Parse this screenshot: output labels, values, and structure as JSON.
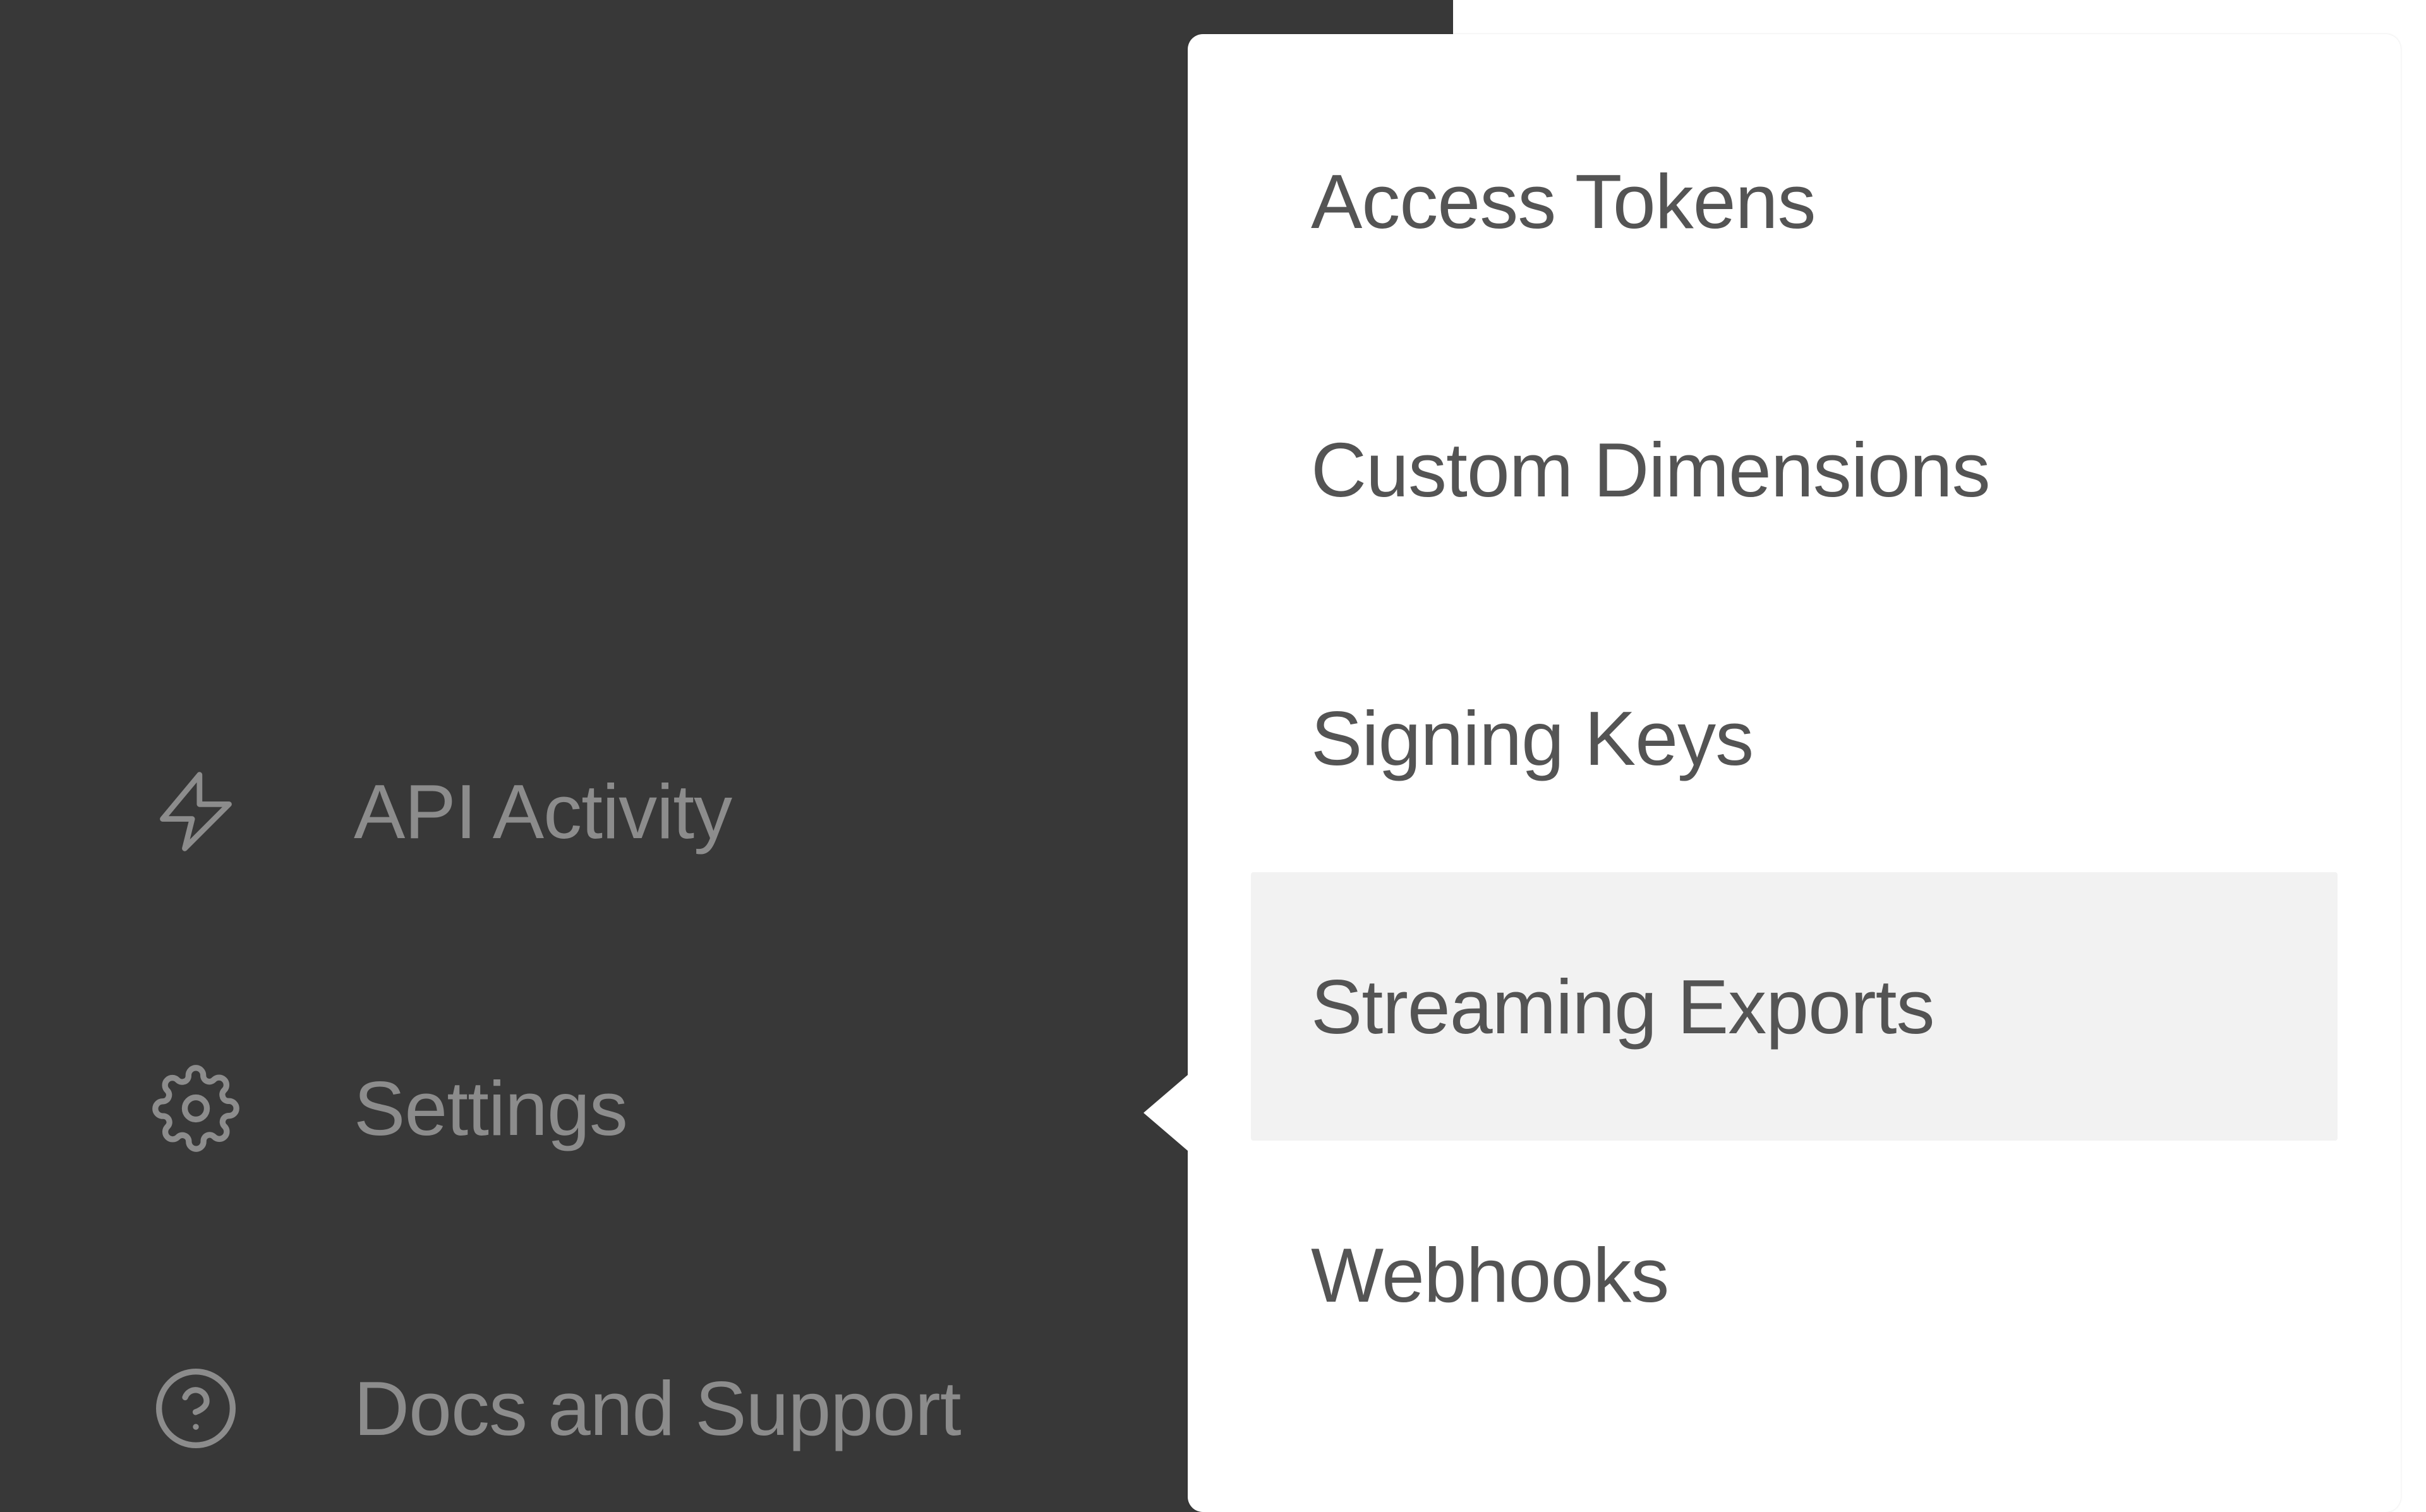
{
  "sidebar": {
    "items": [
      {
        "label": "API Activity"
      },
      {
        "label": "Settings"
      },
      {
        "label": "Docs and Support"
      }
    ]
  },
  "submenu": {
    "items": [
      {
        "label": "Access Tokens",
        "hover": false
      },
      {
        "label": "Custom Dimensions",
        "hover": false
      },
      {
        "label": "Signing Keys",
        "hover": false
      },
      {
        "label": "Streaming Exports",
        "hover": true
      },
      {
        "label": "Webhooks",
        "hover": false
      }
    ]
  }
}
